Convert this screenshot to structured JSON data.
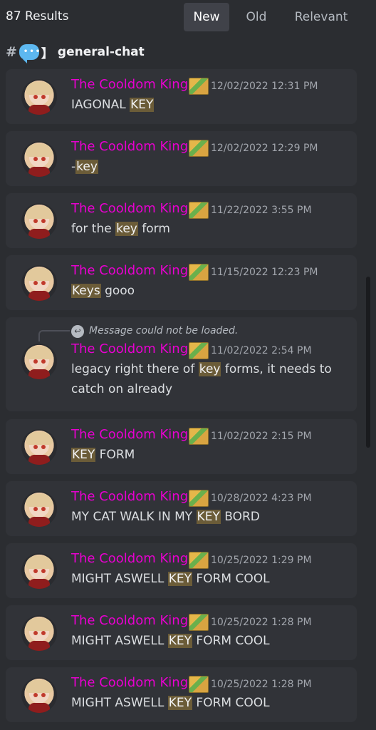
{
  "header": {
    "results": "87 Results",
    "tabs": [
      "New",
      "Old",
      "Relevant"
    ],
    "active_tab": "New"
  },
  "channel": {
    "prefix": "#",
    "emoji": "speech-bubble",
    "bracket": "】",
    "name": "general-chat"
  },
  "messages": [
    {
      "author": "The Cooldom King",
      "time": "12/02/2022 12:31 PM",
      "parts": [
        "IAGONAL ",
        "KEY",
        ""
      ]
    },
    {
      "author": "The Cooldom King",
      "time": "12/02/2022 12:29 PM",
      "parts": [
        "-",
        "key",
        ""
      ]
    },
    {
      "author": "The Cooldom King",
      "time": "11/22/2022 3:55 PM",
      "parts": [
        "for the ",
        "key",
        " form"
      ]
    },
    {
      "author": "The Cooldom King",
      "time": "11/15/2022 12:23 PM",
      "parts": [
        "",
        "Keys",
        " gooo"
      ]
    },
    {
      "author": "The Cooldom King",
      "time": "11/02/2022 2:54 PM",
      "reply": "Message could not be loaded.",
      "parts": [
        "legacy right there of ",
        "key",
        " forms, it needs to catch on already"
      ]
    },
    {
      "author": "The Cooldom King",
      "time": "11/02/2022 2:15 PM",
      "parts": [
        "",
        "KEY",
        " FORM"
      ]
    },
    {
      "author": "The Cooldom King",
      "time": "10/28/2022 4:23 PM",
      "parts": [
        "MY CAT WALK IN MY ",
        "KEY",
        " BORD"
      ]
    },
    {
      "author": "The Cooldom King",
      "time": "10/25/2022 1:29 PM",
      "parts": [
        "MIGHT ASWELL ",
        "KEY",
        " FORM COOL"
      ]
    },
    {
      "author": "The Cooldom King",
      "time": "10/25/2022 1:28 PM",
      "parts": [
        "MIGHT ASWELL ",
        "KEY",
        " FORM COOL"
      ]
    },
    {
      "author": "The Cooldom King",
      "time": "10/25/2022 1:28 PM",
      "parts": [
        "MIGHT ASWELL ",
        "KEY",
        " FORM COOL"
      ]
    }
  ],
  "colors": {
    "background": "#2b2d31",
    "card": "#313338",
    "username": "#e800d0",
    "highlight": "#6b5c38"
  }
}
